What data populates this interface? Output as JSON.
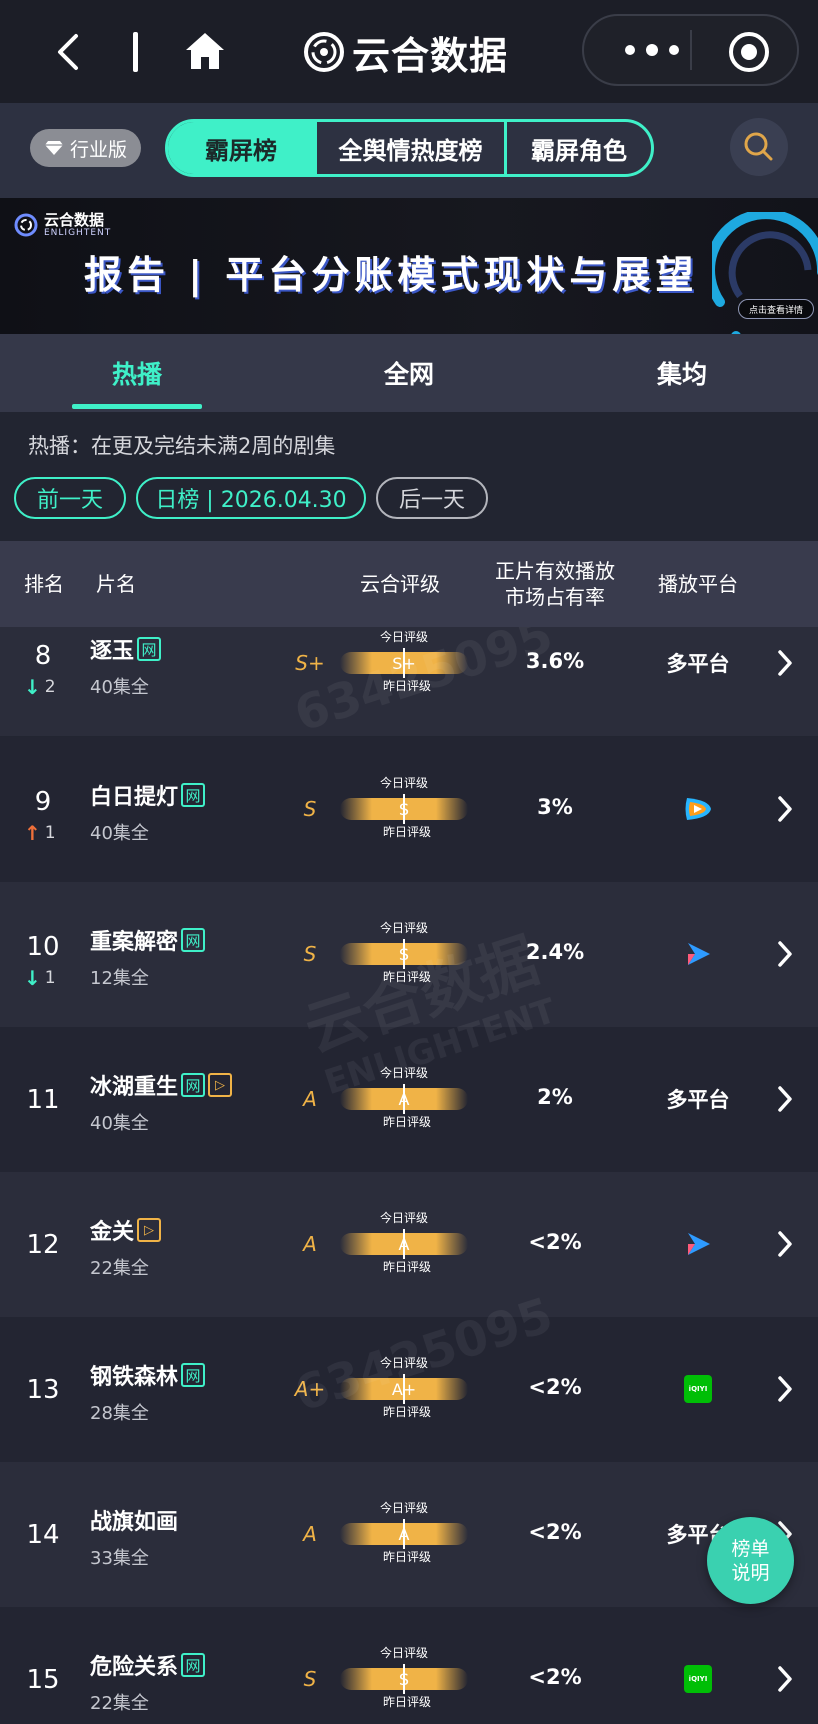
{
  "nav": {
    "brand_name": "云合数据",
    "icons": {
      "back": "back-chevron-icon",
      "home": "home-icon",
      "more": "more-dots-icon",
      "close": "target-close-icon"
    }
  },
  "filter": {
    "industry_badge": "行业版",
    "segments": [
      {
        "label": "霸屏榜",
        "active": true
      },
      {
        "label": "全舆情热度榜",
        "active": false
      },
      {
        "label": "霸屏角色",
        "active": false
      }
    ]
  },
  "banner": {
    "brand_cn": "云合数据",
    "brand_en": "ENLIGHTENT",
    "title": "报告 | 平台分账模式现状与展望",
    "cta": "点击查看详情"
  },
  "tabs": [
    {
      "label": "热播",
      "active": true
    },
    {
      "label": "全网",
      "active": false
    },
    {
      "label": "集均",
      "active": false
    }
  ],
  "description": "热播：在更及完结未满2周的剧集",
  "date_nav": {
    "prev": "前一天",
    "current": "日榜 | 2026.04.30",
    "next": "后一天"
  },
  "table_header": {
    "rank": "排名",
    "title": "片名",
    "grade": "云合评级",
    "share_line1": "正片有效播放",
    "share_line2": "市场占有率",
    "platform": "播放平台"
  },
  "grade_captions": {
    "today": "今日评级",
    "yesterday": "昨日评级"
  },
  "rows": [
    {
      "rank": "8",
      "change_dir": "down",
      "change": "2",
      "title": "逐玉",
      "tags": [
        "网"
      ],
      "episodes": "40集全",
      "grade": "S+",
      "grade_bar": "S+",
      "share": "3.6%",
      "platform": "多平台",
      "platform_icon": ""
    },
    {
      "rank": "9",
      "change_dir": "up",
      "change": "1",
      "title": "白日提灯",
      "tags": [
        "网"
      ],
      "episodes": "40集全",
      "grade": "S",
      "grade_bar": "S",
      "share": "3%",
      "platform": "",
      "platform_icon": "tencent-video-icon"
    },
    {
      "rank": "10",
      "change_dir": "down",
      "change": "1",
      "title": "重案解密",
      "tags": [
        "网"
      ],
      "episodes": "12集全",
      "grade": "S",
      "grade_bar": "S",
      "share": "2.4%",
      "platform": "",
      "platform_icon": "youku-icon"
    },
    {
      "rank": "11",
      "change_dir": "",
      "change": "",
      "title": "冰湖重生",
      "tags": [
        "网",
        "play"
      ],
      "episodes": "40集全",
      "grade": "A",
      "grade_bar": "A",
      "share": "2%",
      "platform": "多平台",
      "platform_icon": ""
    },
    {
      "rank": "12",
      "change_dir": "",
      "change": "",
      "title": "金关",
      "tags": [
        "play"
      ],
      "episodes": "22集全",
      "grade": "A",
      "grade_bar": "A",
      "share": "<2%",
      "platform": "",
      "platform_icon": "youku-icon"
    },
    {
      "rank": "13",
      "change_dir": "",
      "change": "",
      "title": "钢铁森林",
      "tags": [
        "网"
      ],
      "episodes": "28集全",
      "grade": "A+",
      "grade_bar": "A+",
      "share": "<2%",
      "platform": "",
      "platform_icon": "iqiyi-icon"
    },
    {
      "rank": "14",
      "change_dir": "",
      "change": "",
      "title": "战旗如画",
      "tags": [],
      "episodes": "33集全",
      "grade": "A",
      "grade_bar": "A",
      "share": "<2%",
      "platform": "多平台",
      "platform_icon": ""
    },
    {
      "rank": "15",
      "change_dir": "",
      "change": "",
      "title": "危险关系",
      "tags": [
        "网"
      ],
      "episodes": "22集全",
      "grade": "S",
      "grade_bar": "S",
      "share": "<2%",
      "platform": "",
      "platform_icon": "iqiyi-icon"
    }
  ],
  "tag_net_label": "网",
  "iqiyi_label": "iQIYI",
  "fab": {
    "line1": "榜单",
    "line2": "说明"
  },
  "watermarks": [
    "63425095",
    "云合数据",
    "ENLIGHTENT"
  ],
  "colors": {
    "accent": "#3ff0c8",
    "grade": "#f0b347",
    "up": "#f0703a",
    "down": "#3ff0c8",
    "bg": "#222531"
  }
}
